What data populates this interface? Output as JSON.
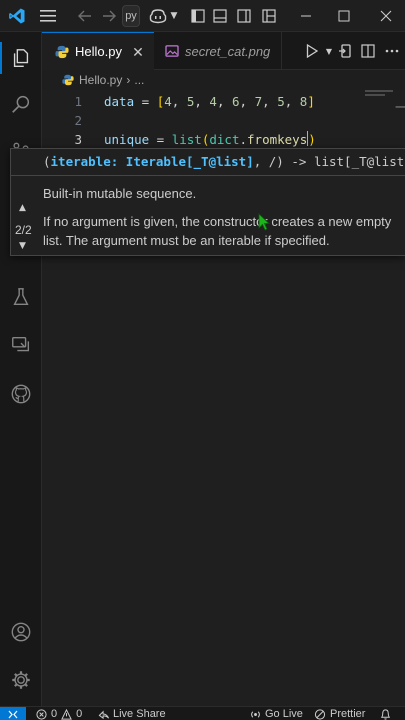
{
  "titlebar": {
    "command_center_text": "py",
    "icons": [
      "vscode-logo",
      "menu-icon",
      "back-arrow-icon",
      "forward-arrow-icon",
      "copilot-icon",
      "toggle-primary-sidebar-icon",
      "toggle-panel-icon",
      "toggle-secondary-sidebar-icon",
      "customize-layout-icon",
      "minimize-icon",
      "maximize-icon",
      "close-icon"
    ]
  },
  "activitybar": {
    "items": [
      "explorer-icon",
      "search-icon",
      "source-control-icon",
      "run-debug-icon",
      "extensions-icon",
      "testing-icon",
      "remote-explorer-icon",
      "github-icon"
    ],
    "bottom": [
      "accounts-icon",
      "manage-gear-icon"
    ]
  },
  "tabs": [
    {
      "label": "Hello.py",
      "active": true,
      "icon": "python-file-icon"
    },
    {
      "label": "secret_cat.png",
      "active": false,
      "icon": "image-file-icon"
    }
  ],
  "breadcrumb": {
    "file": "Hello.py",
    "more": "..."
  },
  "editor": {
    "lines": [
      {
        "num": "1",
        "tokens": [
          {
            "t": "data",
            "c": "v"
          },
          {
            "t": " = ",
            "c": ""
          },
          {
            "t": "[",
            "c": "b1"
          },
          {
            "t": "4",
            "c": "n"
          },
          {
            "t": ", ",
            "c": ""
          },
          {
            "t": "5",
            "c": "n"
          },
          {
            "t": ", ",
            "c": ""
          },
          {
            "t": "4",
            "c": "n"
          },
          {
            "t": ", ",
            "c": ""
          },
          {
            "t": "6",
            "c": "n"
          },
          {
            "t": ", ",
            "c": ""
          },
          {
            "t": "7",
            "c": "n"
          },
          {
            "t": ", ",
            "c": ""
          },
          {
            "t": "5",
            "c": "n"
          },
          {
            "t": ", ",
            "c": ""
          },
          {
            "t": "8",
            "c": "n"
          },
          {
            "t": "]",
            "c": "b1"
          }
        ]
      },
      {
        "num": "2",
        "tokens": []
      },
      {
        "num": "3",
        "tokens": [
          {
            "t": "unique",
            "c": "v"
          },
          {
            "t": " = ",
            "c": ""
          },
          {
            "t": "list",
            "c": "cls"
          },
          {
            "t": "(",
            "c": "b1"
          },
          {
            "t": "dict",
            "c": "cls"
          },
          {
            "t": ".",
            "c": ""
          },
          {
            "t": "fromkeys",
            "c": "f"
          },
          {
            "t": "|",
            "c": "cursor"
          },
          {
            "t": ")",
            "c": "b1"
          }
        ]
      }
    ]
  },
  "signature_help": {
    "signature_open": "(",
    "param": "iterable: Iterable[_T@list]",
    "signature_rest": ", /) -> list[_T@list]",
    "doc_summary": "Built-in mutable sequence.",
    "doc_detail": "If no argument is given, the constructor creates a new empty list. The argument must be an iterable if specified.",
    "overload_counter": "2/2"
  },
  "statusbar": {
    "errors": "0",
    "warnings": "0",
    "live_share": "Live Share",
    "go_live": "Go Live",
    "prettier": "Prettier"
  },
  "colors": {
    "accent": "#0078d4",
    "editor_bg": "#1f1f1f",
    "mouse_cursor": "#1db31d"
  }
}
